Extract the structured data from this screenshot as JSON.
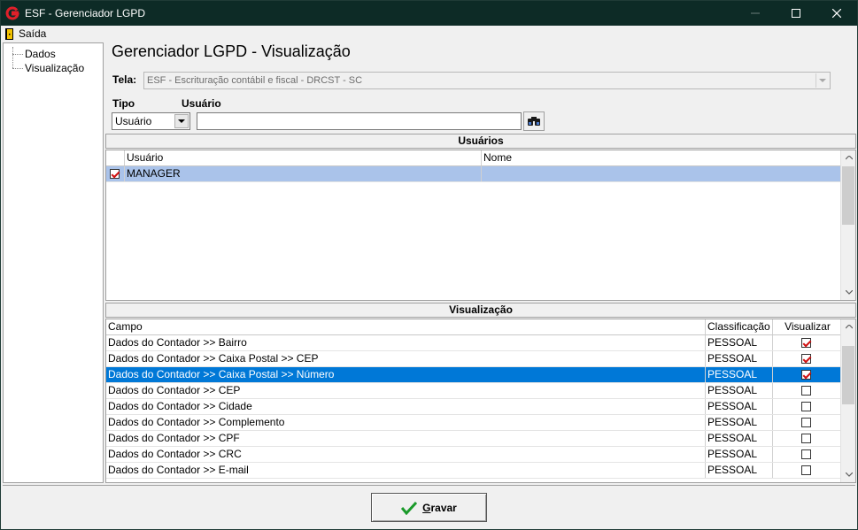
{
  "window": {
    "title": "ESF - Gerenciador LGPD",
    "minimize_icon": "minimize-icon",
    "maximize_icon": "maximize-icon",
    "close_icon": "close-icon"
  },
  "menu": {
    "exit_label": "Saída",
    "exit_icon": "door-exit-icon"
  },
  "nav": {
    "items": [
      {
        "label": "Dados"
      },
      {
        "label": "Visualização"
      }
    ]
  },
  "main": {
    "title": "Gerenciador LGPD - Visualização",
    "tela_label": "Tela:",
    "tela_value": "ESF - Escrituração contábil e fiscal - DRCST - SC",
    "tipo_label": "Tipo",
    "tipo_value": "Usuário",
    "usuario_label": "Usuário",
    "usuario_value": "",
    "search_icon": "binoculars-search-icon"
  },
  "usuarios": {
    "header": "Usuários",
    "columns": [
      "Usuário",
      "Nome"
    ],
    "rows": [
      {
        "checked": true,
        "usuario": "MANAGER",
        "nome": ""
      }
    ]
  },
  "visualizacao": {
    "header": "Visualização",
    "columns": [
      "Campo",
      "Classificação",
      "Visualizar"
    ],
    "rows": [
      {
        "campo": "Dados do Contador >> Bairro",
        "classificacao": "PESSOAL",
        "visualizar": true
      },
      {
        "campo": "Dados do Contador >> Caixa Postal >> CEP",
        "classificacao": "PESSOAL",
        "visualizar": true
      },
      {
        "campo": "Dados do Contador >> Caixa Postal >> Número",
        "classificacao": "PESSOAL",
        "visualizar": true,
        "selected": true
      },
      {
        "campo": "Dados do Contador >> CEP",
        "classificacao": "PESSOAL",
        "visualizar": false
      },
      {
        "campo": "Dados do Contador >> Cidade",
        "classificacao": "PESSOAL",
        "visualizar": false
      },
      {
        "campo": "Dados do Contador >> Complemento",
        "classificacao": "PESSOAL",
        "visualizar": false
      },
      {
        "campo": "Dados do Contador >> CPF",
        "classificacao": "PESSOAL",
        "visualizar": false
      },
      {
        "campo": "Dados do Contador >> CRC",
        "classificacao": "PESSOAL",
        "visualizar": false
      },
      {
        "campo": "Dados do Contador >> E-mail",
        "classificacao": "PESSOAL",
        "visualizar": false
      }
    ]
  },
  "footer": {
    "gravar_label": "Gravar",
    "gravar_underline": "G",
    "gravar_rest": "ravar",
    "check_icon": "green-check-icon"
  },
  "colors": {
    "titlebar": "#0d2b26",
    "selection": "#0078d7",
    "soft_selection": "#aac3ea",
    "checkmark": "#d01010",
    "accent_green": "#1a9a2a"
  }
}
